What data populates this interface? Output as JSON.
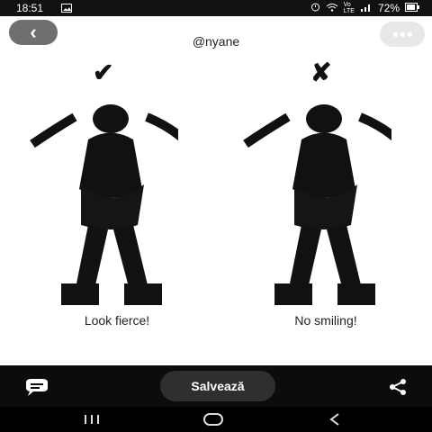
{
  "status": {
    "time": "18:51",
    "battery": "72%",
    "icons": [
      "image-icon",
      "alarm-icon",
      "wifi-icon",
      "volte-icon",
      "signal-icon",
      "battery-icon"
    ]
  },
  "pin": {
    "username": "@nyane",
    "left": {
      "mark": "✔",
      "caption": "Look fierce!"
    },
    "right": {
      "mark": "✘",
      "caption": "No smiling!"
    }
  },
  "actions": {
    "save_label": "Salvează"
  },
  "colors": {
    "save_bg": "#2f2f2f",
    "bar_bg": "#0c0c0c",
    "back_bg": "#6f6f6f"
  }
}
